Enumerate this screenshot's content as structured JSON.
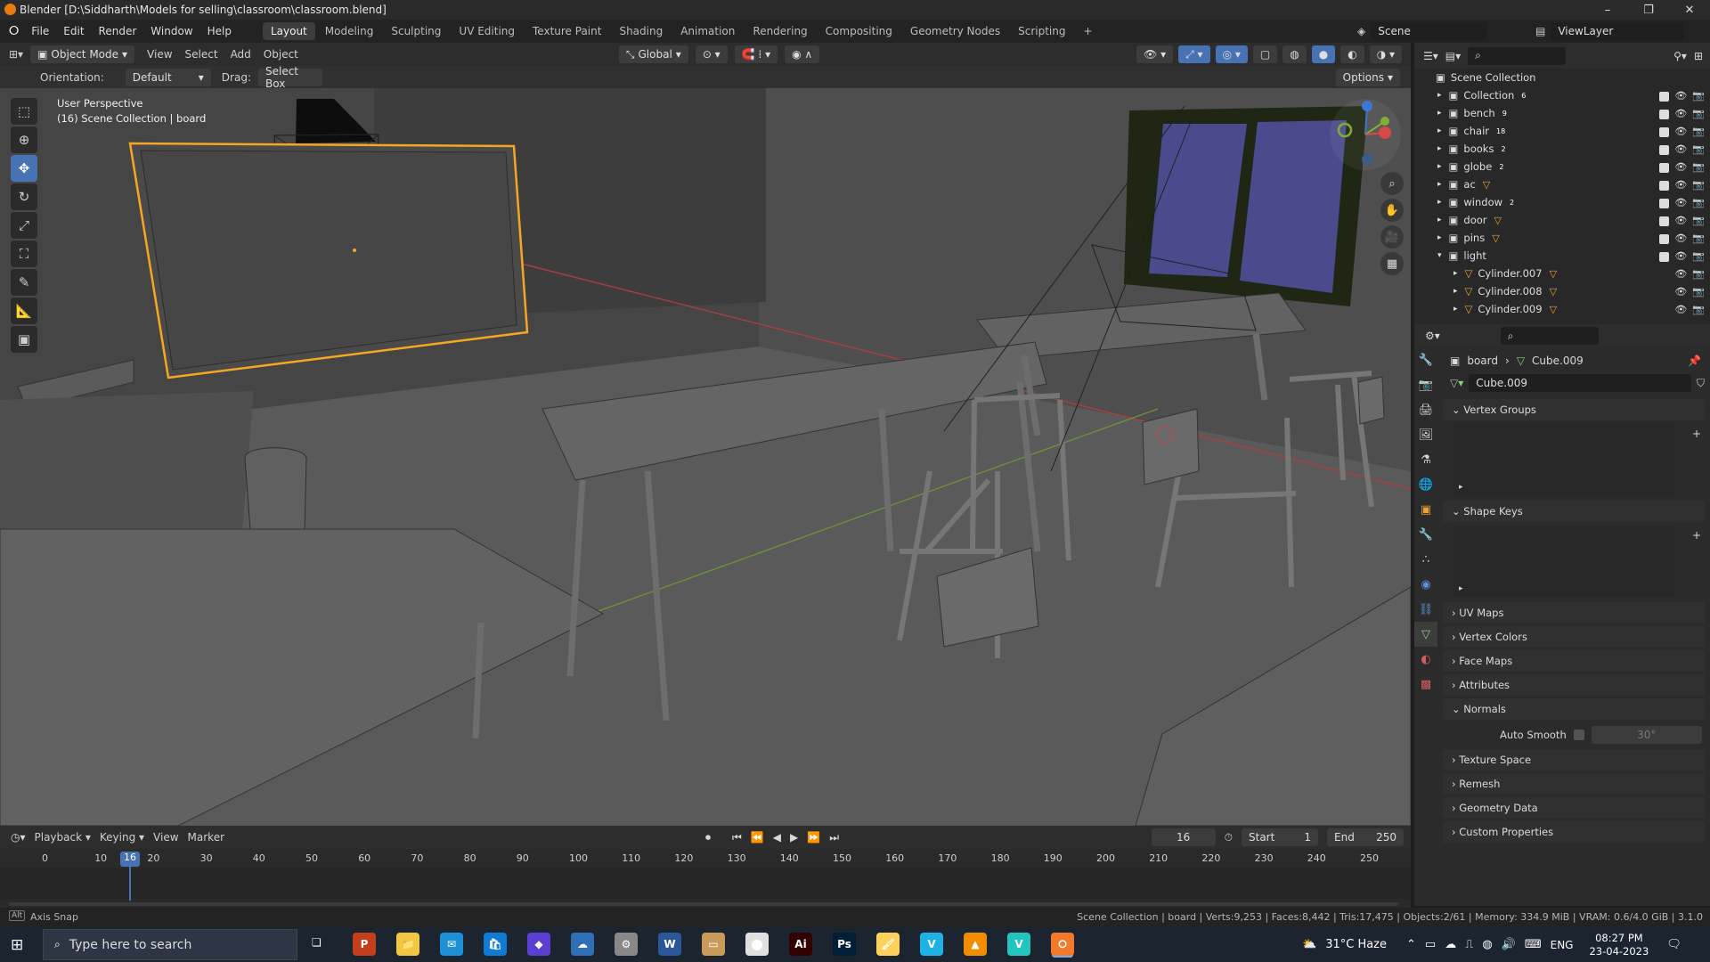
{
  "window": {
    "title": "Blender [D:\\Siddharth\\Models for selling\\classroom\\classroom.blend]",
    "controls": [
      "–",
      "❐",
      "✕"
    ]
  },
  "menu": {
    "items": [
      "File",
      "Edit",
      "Render",
      "Window",
      "Help"
    ]
  },
  "workspaces": [
    "Layout",
    "Modeling",
    "Sculpting",
    "UV Editing",
    "Texture Paint",
    "Shading",
    "Animation",
    "Rendering",
    "Compositing",
    "Geometry Nodes",
    "Scripting"
  ],
  "active_workspace": "Layout",
  "scene": {
    "name": "Scene",
    "view_layer": "ViewLayer"
  },
  "viewport_header": {
    "mode": "Object Mode",
    "menus": [
      "View",
      "Select",
      "Add",
      "Object"
    ],
    "transform": "Global",
    "options": "Options"
  },
  "tool_settings": {
    "orientation_label": "Orientation:",
    "orientation": "Default",
    "drag_label": "Drag:",
    "drag": "Select Box"
  },
  "viewport": {
    "perspective": "User Perspective",
    "info": "(16) Scene Collection | board"
  },
  "outliner": {
    "root": "Scene Collection",
    "rows": [
      {
        "name": "Collection",
        "badge": "6"
      },
      {
        "name": "bench",
        "badge": "9"
      },
      {
        "name": "chair",
        "badge": "18"
      },
      {
        "name": "books",
        "badge": "2"
      },
      {
        "name": "globe",
        "badge": "2"
      },
      {
        "name": "ac",
        "badge": ""
      },
      {
        "name": "window",
        "badge": "2"
      },
      {
        "name": "door",
        "badge": ""
      },
      {
        "name": "pins",
        "badge": ""
      },
      {
        "name": "light",
        "badge": ""
      },
      {
        "name": "Cylinder.007",
        "badge": ""
      },
      {
        "name": "Cylinder.008",
        "badge": ""
      },
      {
        "name": "Cylinder.009",
        "badge": ""
      }
    ]
  },
  "properties": {
    "breadcrumb_object": "board",
    "breadcrumb_mesh": "Cube.009",
    "mesh_name": "Cube.009",
    "panels": {
      "vertex_groups": "Vertex Groups",
      "shape_keys": "Shape Keys",
      "uv_maps": "UV Maps",
      "vertex_colors": "Vertex Colors",
      "face_maps": "Face Maps",
      "attributes": "Attributes",
      "normals": "Normals",
      "texture_space": "Texture Space",
      "remesh": "Remesh",
      "geometry_data": "Geometry Data",
      "custom_properties": "Custom Properties"
    },
    "auto_smooth_label": "Auto Smooth",
    "auto_smooth_angle": "30°"
  },
  "timeline": {
    "menus": [
      "Playback",
      "Keying",
      "View",
      "Marker"
    ],
    "current_frame": "16",
    "start_label": "Start",
    "start": "1",
    "end_label": "End",
    "end": "250",
    "ticks": [
      "0",
      "10",
      "20",
      "30",
      "40",
      "50",
      "60",
      "70",
      "80",
      "90",
      "100",
      "110",
      "120",
      "130",
      "140",
      "150",
      "160",
      "170",
      "180",
      "190",
      "200",
      "210",
      "220",
      "230",
      "240",
      "250"
    ]
  },
  "status_bar": {
    "left": "Axis Snap",
    "right": "Scene Collection | board | Verts:9,253 | Faces:8,442 | Tris:17,475 | Objects:2/61 | Memory: 334.9 MiB | VRAM: 0.6/4.0 GiB | 3.1.0"
  },
  "taskbar": {
    "search_placeholder": "Type here to search",
    "weather": "31°C Haze",
    "language": "ENG",
    "time": "08:27 PM",
    "date": "23-04-2023",
    "app_icons": [
      "P",
      "📁",
      "✉",
      "🛍",
      "◆",
      "☁",
      "⚙",
      "W",
      "▭",
      "⬤",
      "Ai",
      "Ps",
      "🖌",
      "V",
      "▲",
      "V",
      "⭘"
    ]
  },
  "colors": {
    "accent": "#4772b3",
    "selection": "#f5a623",
    "viewport_bg": "#3b3b3b",
    "window_glass": "#4a4a8c"
  }
}
